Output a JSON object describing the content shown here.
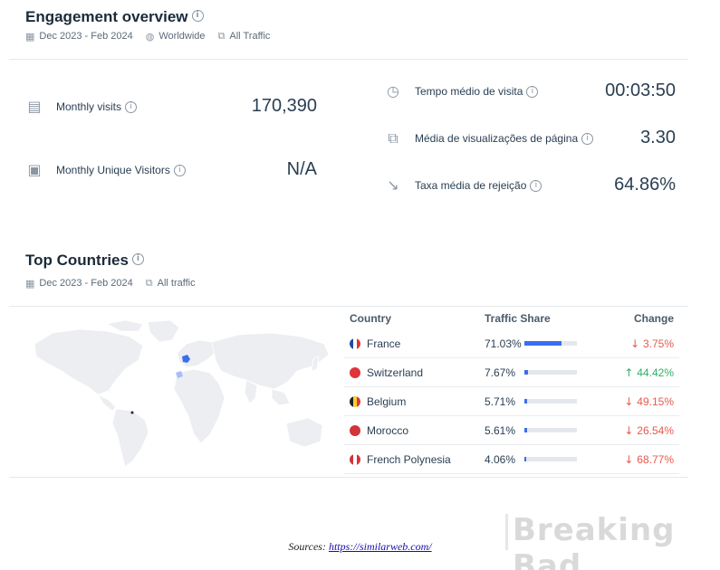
{
  "engagement": {
    "title": "Engagement overview",
    "date_range": "Dec 2023 - Feb 2024",
    "region": "Worldwide",
    "traffic": "All Traffic",
    "metrics_left": [
      {
        "label": "Monthly visits",
        "value": "170,390",
        "icon": "calendar-icon"
      },
      {
        "label": "Monthly Unique Visitors",
        "value": "N/A",
        "icon": "person-card-icon"
      }
    ],
    "metrics_right": [
      {
        "label": "Tempo médio de visita",
        "value": "00:03:50",
        "icon": "stopwatch-icon"
      },
      {
        "label": "Média de visualizações de página",
        "value": "3.30",
        "icon": "pages-icon"
      },
      {
        "label": "Taxa média de rejeição",
        "value": "64.86%",
        "icon": "bounce-arrow-icon"
      }
    ]
  },
  "top_countries": {
    "title": "Top Countries",
    "date_range": "Dec 2023 - Feb 2024",
    "traffic": "All traffic",
    "columns": [
      "Country",
      "Traffic Share",
      "Change"
    ],
    "rows": [
      {
        "country": "France",
        "share": "71.03%",
        "share_num": 71.03,
        "change": "3.75%",
        "direction": "down",
        "flag": [
          "#1f4aa8",
          "#ffffff",
          "#e0343a"
        ]
      },
      {
        "country": "Switzerland",
        "share": "7.67%",
        "share_num": 7.67,
        "change": "44.42%",
        "direction": "up",
        "flag": [
          "#e0343a"
        ]
      },
      {
        "country": "Belgium",
        "share": "5.71%",
        "share_num": 5.71,
        "change": "49.15%",
        "direction": "down",
        "flag": [
          "#222222",
          "#f5d130",
          "#e0343a"
        ]
      },
      {
        "country": "Morocco",
        "share": "5.61%",
        "share_num": 5.61,
        "change": "26.54%",
        "direction": "down",
        "flag": [
          "#d1343a"
        ]
      },
      {
        "country": "French Polynesia",
        "share": "4.06%",
        "share_num": 4.06,
        "change": "68.77%",
        "direction": "down",
        "flag": [
          "#d1343a",
          "#ffffff",
          "#d1343a"
        ]
      }
    ]
  },
  "footer": {
    "sources_label": "Sources: ",
    "sources_link": "https://similarweb.com/"
  },
  "watermark": "Breaking Bad",
  "colors": {
    "accent": "#3c6df0",
    "down": "#e45a4d",
    "up": "#2fae67"
  }
}
